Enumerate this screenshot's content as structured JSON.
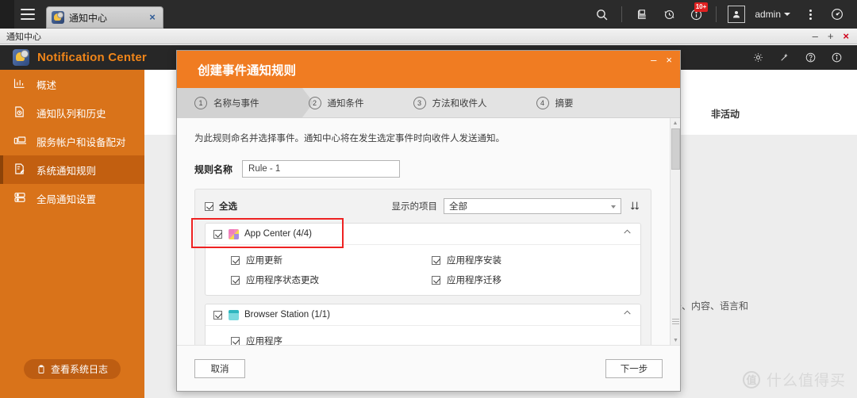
{
  "browser": {
    "tab": {
      "title": "通知中心",
      "favicon": "bell-gear-icon",
      "close": "×"
    },
    "menu_icon": "hamburger-icon",
    "toolbar": [
      {
        "name": "search-icon",
        "glyph": "search"
      },
      {
        "name": "file-manager-icon",
        "glyph": "files"
      },
      {
        "name": "sync-icon",
        "glyph": "sync"
      },
      {
        "name": "info-icon",
        "glyph": "info",
        "badge": "10+"
      },
      {
        "name": "user-avatar-icon",
        "glyph": "avatar"
      }
    ],
    "admin_label": "admin",
    "more_icon": "vertical-dots-icon",
    "dashboard_icon": "speedometer-icon"
  },
  "window": {
    "title": "通知中心",
    "minimize": "–",
    "maximize": "+",
    "close": "×"
  },
  "app": {
    "title": "Notification Center",
    "header_icons": [
      "gear-icon",
      "wand-icon",
      "help-icon",
      "info-icon"
    ]
  },
  "sidebar": {
    "items": [
      {
        "label": "概述",
        "icon": "chart-bar-icon",
        "active": false
      },
      {
        "label": "通知队列和历史",
        "icon": "history-icon",
        "active": false
      },
      {
        "label": "服务帐户和设备配对",
        "icon": "devices-icon",
        "active": false
      },
      {
        "label": "系统通知规则",
        "icon": "rules-icon",
        "active": true
      },
      {
        "label": "全局通知设置",
        "icon": "settings-icon",
        "active": false
      }
    ],
    "log_button": {
      "label": "查看系统日志",
      "icon": "clipboard-icon"
    }
  },
  "background": {
    "inactive_label": "非活动",
    "partial_text": "法、内容、语言和"
  },
  "watermark": {
    "logo": "值",
    "text": "什么值得买"
  },
  "dialog": {
    "title": "创建事件通知规则",
    "minimize": "–",
    "close": "×",
    "steps": [
      {
        "num": "1",
        "label": "名称与事件",
        "active": true
      },
      {
        "num": "2",
        "label": "通知条件",
        "active": false
      },
      {
        "num": "3",
        "label": "方法和收件人",
        "active": false
      },
      {
        "num": "4",
        "label": "摘要",
        "active": false
      }
    ],
    "intro": "为此规则命名并选择事件。通知中心将在发生选定事件时向收件人发送通知。",
    "rule_name_label": "规则名称",
    "rule_name_value": "Rule - 1",
    "rule_name_placeholder": "Rule - 1",
    "select_all_label": "全选",
    "filter_label": "显示的项目",
    "filter_value": "全部",
    "sort_icon": "sort-descending-icon",
    "groups": [
      {
        "title": "App Center (4/4)",
        "icon": "app-center-icon",
        "checked": true,
        "expanded": true,
        "items": [
          {
            "label": "应用更新",
            "checked": true
          },
          {
            "label": "应用程序安装",
            "checked": true
          },
          {
            "label": "应用程序状态更改",
            "checked": true
          },
          {
            "label": "应用程序迁移",
            "checked": true
          }
        ]
      },
      {
        "title": "Browser Station (1/1)",
        "icon": "browser-station-icon",
        "checked": true,
        "expanded": true,
        "items": [
          {
            "label": "应用程序",
            "checked": true
          }
        ]
      }
    ],
    "cancel_label": "取消",
    "next_label": "下一步"
  },
  "colors": {
    "accent_orange": "#f07c22",
    "sidebar_orange": "#d9731a",
    "annotation_red": "#ee2222",
    "badge_red": "#e02020"
  }
}
